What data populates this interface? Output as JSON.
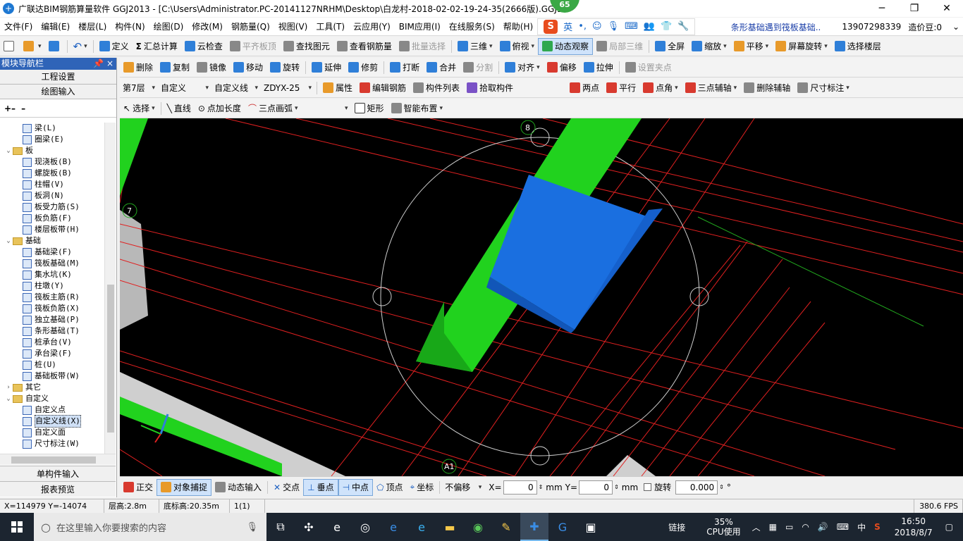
{
  "window": {
    "title": "广联达BIM钢筋算量软件 GGJ2013 - [C:\\Users\\Administrator.PC-20141127NRHM\\Desktop\\白龙村-2018-02-02-19-24-35(2666版).GGJ12",
    "badge": "65"
  },
  "menu": {
    "items": [
      "文件(F)",
      "编辑(E)",
      "楼层(L)",
      "构件(N)",
      "绘图(D)",
      "修改(M)",
      "钢筋量(Q)",
      "视图(V)",
      "工具(T)",
      "云应用(Y)",
      "BIM应用(I)",
      "在线服务(S)",
      "帮助(H)"
    ],
    "ime_label": "英",
    "hint": "条形基础遇到筏板基础..",
    "user": "13907298339",
    "price": "造价豆:0"
  },
  "toolbar1": {
    "items": [
      "定义",
      "汇总计算",
      "云检查",
      "平齐板顶",
      "查找图元",
      "查看钢筋量",
      "批量选择",
      "三维",
      "俯视",
      "动态观察",
      "局部三维",
      "全屏",
      "缩放",
      "平移",
      "屏幕旋转",
      "选择楼层"
    ]
  },
  "toolbar2": {
    "items": [
      "删除",
      "复制",
      "镜像",
      "移动",
      "旋转",
      "延伸",
      "修剪",
      "打断",
      "合并",
      "分割",
      "对齐",
      "偏移",
      "拉伸",
      "设置夹点"
    ]
  },
  "toolbar3": {
    "floor": "第7层",
    "type": "自定义",
    "subtype": "自定义线",
    "name": "ZDYX-25",
    "items": [
      "属性",
      "编辑钢筋",
      "构件列表",
      "拾取构件"
    ],
    "right_items": [
      "两点",
      "平行",
      "点角",
      "三点辅轴",
      "删除辅轴",
      "尺寸标注"
    ]
  },
  "toolbar4": {
    "items": [
      "选择",
      "直线",
      "点加长度",
      "三点画弧",
      "矩形",
      "智能布置"
    ]
  },
  "left_panel": {
    "title": "模块导航栏",
    "pin": "📌 ×",
    "section1": "工程设置",
    "section2": "绘图输入",
    "tree": [
      {
        "label": "梁(L)",
        "level": 2
      },
      {
        "label": "圈梁(E)",
        "level": 2
      },
      {
        "label": "板",
        "level": 1,
        "folder": true
      },
      {
        "label": "现浇板(B)",
        "level": 2
      },
      {
        "label": "螺旋板(B)",
        "level": 2
      },
      {
        "label": "柱帽(V)",
        "level": 2
      },
      {
        "label": "板洞(N)",
        "level": 2
      },
      {
        "label": "板受力筋(S)",
        "level": 2
      },
      {
        "label": "板负筋(F)",
        "level": 2
      },
      {
        "label": "楼层板带(H)",
        "level": 2
      },
      {
        "label": "基础",
        "level": 1,
        "folder": true
      },
      {
        "label": "基础梁(F)",
        "level": 2
      },
      {
        "label": "筏板基础(M)",
        "level": 2
      },
      {
        "label": "集水坑(K)",
        "level": 2
      },
      {
        "label": "柱墩(Y)",
        "level": 2
      },
      {
        "label": "筏板主筋(R)",
        "level": 2
      },
      {
        "label": "筏板负筋(X)",
        "level": 2
      },
      {
        "label": "独立基础(P)",
        "level": 2
      },
      {
        "label": "条形基础(T)",
        "level": 2
      },
      {
        "label": "桩承台(V)",
        "level": 2
      },
      {
        "label": "承台梁(F)",
        "level": 2
      },
      {
        "label": "桩(U)",
        "level": 2
      },
      {
        "label": "基础板带(W)",
        "level": 2
      },
      {
        "label": "其它",
        "level": 1,
        "folder": true,
        "collapsed": true
      },
      {
        "label": "自定义",
        "level": 1,
        "folder": true
      },
      {
        "label": "自定义点",
        "level": 2
      },
      {
        "label": "自定义线(X)",
        "level": 2,
        "selected": true
      },
      {
        "label": "自定义面",
        "level": 2
      },
      {
        "label": "尺寸标注(W)",
        "level": 2
      }
    ],
    "bottom1": "单构件输入",
    "bottom2": "报表预览"
  },
  "canvas": {
    "axis_labels": [
      "8",
      "7",
      "A1"
    ],
    "colors": {
      "bg": "#000000",
      "grid": "#e02020",
      "beam": "#21d21e",
      "slab": "#1a6fe0"
    }
  },
  "snapbar": {
    "items": [
      "正交",
      "对象捕捉",
      "动态输入",
      "交点",
      "垂点",
      "中点",
      "顶点",
      "坐标"
    ],
    "offset": "不偏移",
    "x_label": "X=",
    "x_value": "0",
    "y_label": "Y=",
    "y_value": "0",
    "unit": "mm",
    "rotate_label": "旋转",
    "rotate_value": "0.000",
    "degree": "°"
  },
  "statusbar": {
    "coords": "X=114979 Y=-14074",
    "floor_height": "层高:2.8m",
    "base_height": "底标高:20.35m",
    "count": "1(1)",
    "fps": "380.6 FPS"
  },
  "taskbar": {
    "search_placeholder": "在这里输入你要搜索的内容",
    "link": "链接",
    "cpu": "35%",
    "cpu_label": "CPU使用",
    "ime": "中",
    "time": "16:50",
    "date": "2018/8/7"
  }
}
